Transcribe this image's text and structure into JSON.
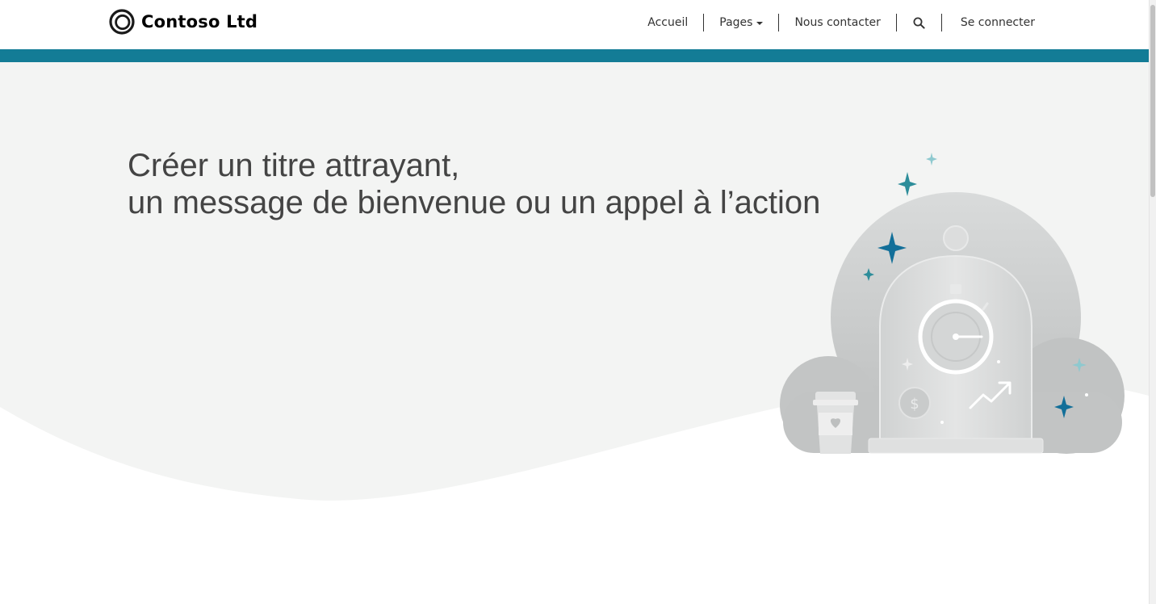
{
  "header": {
    "brand_name": "Contoso Ltd",
    "brand_icon": "ring-logo-icon"
  },
  "nav": {
    "items": [
      {
        "label": "Accueil"
      },
      {
        "label": "Pages",
        "has_dropdown": true
      },
      {
        "label": "Nous contacter"
      }
    ],
    "search_icon": "search-icon",
    "signin_label": "Se connecter"
  },
  "hero": {
    "title_line1": "Créer un titre attrayant,",
    "title_line2": "un message de bienvenue ou un appel à l’action",
    "illustration": "cloud-bell-jar-stopwatch-illustration"
  },
  "colors": {
    "accent": "#137c96",
    "hero_background": "#f3f4f3",
    "text": "#444444"
  }
}
